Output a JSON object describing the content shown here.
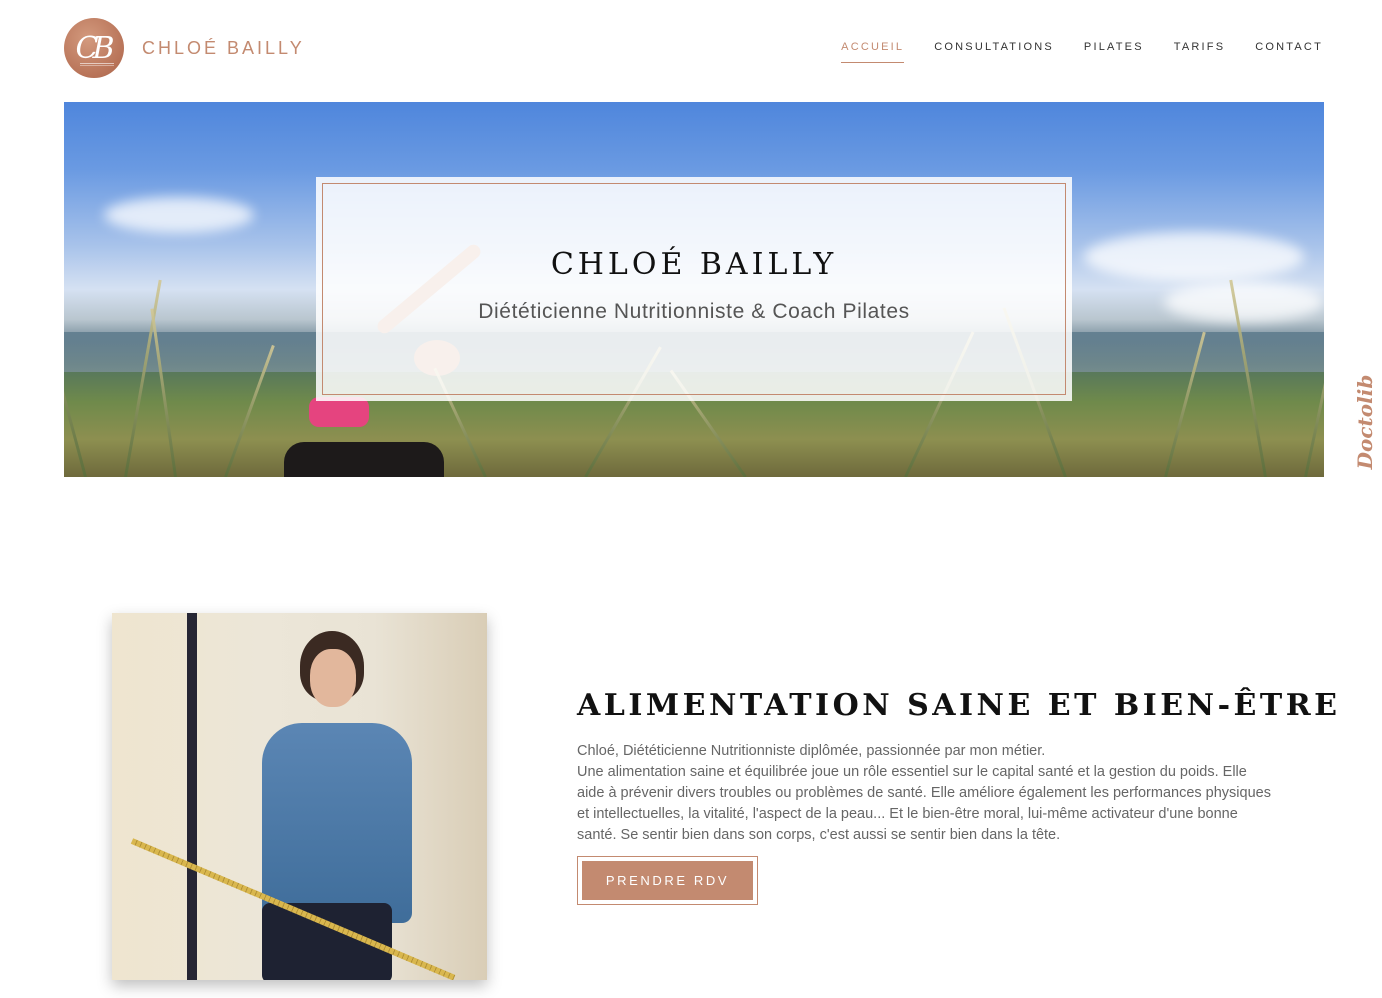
{
  "header": {
    "logo_icon": "cb-monogram-logo",
    "logo_letters": "CB",
    "brand": "CHLOÉ BAILLY",
    "nav": [
      {
        "label": "ACCUEIL",
        "active": true
      },
      {
        "label": "CONSULTATIONS",
        "active": false
      },
      {
        "label": "PILATES",
        "active": false
      },
      {
        "label": "TARIFS",
        "active": false
      },
      {
        "label": "CONTACT",
        "active": false
      }
    ]
  },
  "hero": {
    "title": "CHLOÉ BAILLY",
    "subtitle": "Diététicienne Nutritionniste & Coach Pilates"
  },
  "side_tab": {
    "label": "Doctolib"
  },
  "about": {
    "title": "ALIMENTATION SAINE ET BIEN-ÊTRE",
    "paragraphs": [
      "Chloé, Diététicienne Nutritionniste diplômée, passionnée par mon métier.",
      "Une alimentation saine et équilibrée joue un rôle essentiel sur le capital santé et la gestion du poids. Elle aide à prévenir divers troubles ou problèmes de santé. Elle améliore également les performances physiques et intellectuelles, la vitalité, l'aspect de la peau... Et le bien-être moral, lui-même activateur d'une bonne santé. Se sentir bien dans son corps, c'est aussi se sentir bien dans la tête."
    ],
    "button": "PRENDRE RDV"
  },
  "colors": {
    "accent": "#c38a70",
    "text": "#666666",
    "heading": "#111111"
  }
}
